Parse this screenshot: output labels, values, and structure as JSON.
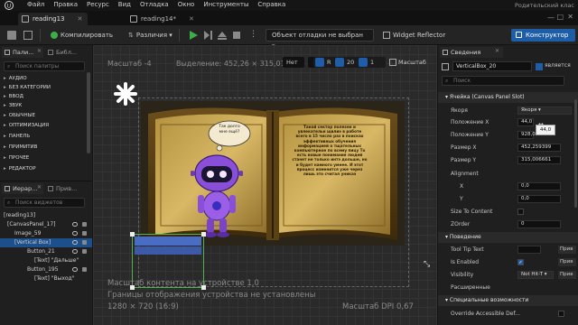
{
  "menubar": {
    "items": [
      "Файл",
      "Правка",
      "Ресурс",
      "Вид",
      "Отладка",
      "Окно",
      "Инструменты",
      "Справка"
    ],
    "right_label": "Родительский клас"
  },
  "tabs": [
    {
      "label": "reading13",
      "active": true
    },
    {
      "label": "reading14*",
      "active": false
    }
  ],
  "toolbar": {
    "compile": "Компилировать",
    "diff": "Различия",
    "debug_object": "Объект отладки не выбран",
    "widget_reflector": "Widget Reflector",
    "constructor": "Конструктор"
  },
  "palette": {
    "tab_palette": "Пали...",
    "tab_library": "Библ...",
    "search_placeholder": "Поиск палитры",
    "categories": [
      "АУДИО",
      "БЕЗ КАТЕГОРИИ",
      "ВВОД",
      "ЗВУК",
      "ОБЫЧНЫЕ",
      "ОПТИМИЗАЦИЯ",
      "ПАНЕЛЬ",
      "ПРИМИТИВ",
      "ПРОЧЕЕ",
      "РЕДАКТОР"
    ]
  },
  "hierarchy": {
    "tab_hierarchy": "Иерар...",
    "tab_bind": "Прив...",
    "search_placeholder": "Поиск виджетов",
    "items": [
      {
        "label": "[reading13]",
        "indent": 0,
        "selected": false
      },
      {
        "label": "[CanvasPanel_17]",
        "indent": 1,
        "selected": false
      },
      {
        "label": "Image_59",
        "indent": 2,
        "selected": false
      },
      {
        "label": "[Vertical Box]",
        "indent": 2,
        "selected": true
      },
      {
        "label": "Button_21",
        "indent": 3,
        "selected": false
      },
      {
        "label": "[Text] \"Дальше\"",
        "indent": 4,
        "selected": false
      },
      {
        "label": "Button_195",
        "indent": 3,
        "selected": false
      },
      {
        "label": "[Text] \"Выход\"",
        "indent": 4,
        "selected": false
      }
    ]
  },
  "viewport": {
    "scale": "Масштаб -4",
    "selection": "Выделение: 452,26 × 315,01",
    "toggle_label": "Нет",
    "snap_value": "R",
    "grid_value": "20",
    "zoom_value": "1",
    "scale_right": "Масштаб",
    "content_scale": "Масштаб контента на устройстве 1,0",
    "device_bounds": "Границы отображения устройства не установлены",
    "resolution": "1280 × 720 (16:9)",
    "dpi": "Масштаб DPI 0,67",
    "bubble_text": "Так долго мне ещё?",
    "book_text": "Такой сектор полезен и увлекательн щвлиэ в работе всего в 15 число раз в поисках эффективных обучения информацией о тщательных компьютерное по всему пицу То есть новые понимания людей станет не только интэ дольше, но и будет намного умнее. И этот процесс изменится уже через лишь это считал уникаэ"
  },
  "details": {
    "tab": "Сведения",
    "name": "VerticalBox_20",
    "is_variable": "является",
    "search_placeholder": "Поиск",
    "slot_section": "Ячейка (Canvas Panel Slot)",
    "anchors_label": "Якоря",
    "anchors_value": "Якоря",
    "pos_x_label": "Положение X",
    "pos_x_value": "44,0",
    "pos_x_tooltip": "44,0",
    "pos_y_label": "Положение Y",
    "pos_y_value": "928,0",
    "size_x_label": "Размер X",
    "size_x_value": "452,259399",
    "size_y_label": "Размер Y",
    "size_y_value": "315,006661",
    "alignment_label": "Alignment",
    "align_x_label": "X",
    "align_x_value": "0,0",
    "align_y_label": "Y",
    "align_y_value": "0,0",
    "size_to_content_label": "Size To Content",
    "zorder_label": "ZOrder",
    "zorder_value": "0",
    "behavior_section": "Поведение",
    "tooltip_label": "Tool Tip Text",
    "tooltip_btn": "Прив",
    "enabled_label": "Is Enabled",
    "enabled_btn": "Прив",
    "visibility_label": "Visibility",
    "visibility_value": "Not Hit-T",
    "visibility_btn": "Прив",
    "advanced_label": "Расширенные",
    "special_section": "Специальные возможности",
    "override_label": "Override Accessible Def..."
  }
}
